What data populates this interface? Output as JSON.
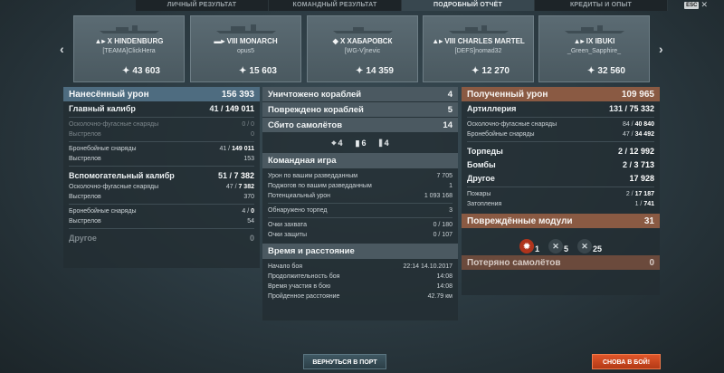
{
  "tabs": [
    "ЛИЧНЫЙ РЕЗУЛЬТАТ",
    "КОМАНДНЫЙ РЕЗУЛЬТАТ",
    "ПОДРОБНЫЙ ОТЧЁТ",
    "КРЕДИТЫ И ОПЫТ"
  ],
  "active_tab": 2,
  "esc_label": "ESC",
  "ships": [
    {
      "tier": "X",
      "name": "HINDENBURG",
      "player": "[TEAMA]ClickHera",
      "damage": "43 603",
      "class_icon": "cruiser-icon"
    },
    {
      "tier": "VIII",
      "name": "MONARCH",
      "player": "opus5",
      "damage": "15 603",
      "class_icon": "battleship-icon"
    },
    {
      "tier": "X",
      "name": "ХАБАРОВСК",
      "player": "[WG-V]nevic",
      "damage": "14 359",
      "class_icon": "destroyer-icon"
    },
    {
      "tier": "VIII",
      "name": "CHARLES MARTEL",
      "player": "[DEFS]nomad32",
      "damage": "12 270",
      "class_icon": "cruiser-icon"
    },
    {
      "tier": "IX",
      "name": "IBUKI",
      "player": "_Green_Sapphire_",
      "damage": "32 560",
      "class_icon": "cruiser-icon"
    }
  ],
  "left": {
    "dealt_label": "Нанесённый урон",
    "dealt_value": "156 393",
    "main_label": "Главный калибр",
    "main_a": "41 / ",
    "main_b": "149 011",
    "main_he_label": "Осколочно-фугасные снаряды",
    "main_he_value": "0 / 0",
    "main_he_shots_label": "Выстрелов",
    "main_he_shots": "0",
    "main_ap_label": "Бронебойные снаряды",
    "main_ap_a": "41 / ",
    "main_ap_b": "149 011",
    "main_ap_shots_label": "Выстрелов",
    "main_ap_shots": "153",
    "sec_label": "Вспомогательный калибр",
    "sec_a": "51 / ",
    "sec_b": "7 382",
    "sec_he_label": "Осколочно-фугасные снаряды",
    "sec_he_a": "47 / ",
    "sec_he_b": "7 382",
    "sec_he_shots_label": "Выстрелов",
    "sec_he_shots": "370",
    "sec_ap_label": "Бронебойные снаряды",
    "sec_ap_a": "4 / ",
    "sec_ap_b": "0",
    "sec_ap_shots_label": "Выстрелов",
    "sec_ap_shots": "54",
    "other_label": "Другое",
    "other_value": "0"
  },
  "mid": {
    "destroyed_label": "Уничтожено кораблей",
    "destroyed_value": "4",
    "damaged_label": "Повреждено кораблей",
    "damaged_value": "5",
    "planes_label": "Сбито самолётов",
    "planes_value": "14",
    "icon_counts": {
      "ribbon1": "4",
      "ribbon2": "6",
      "ribbon3": "4"
    },
    "team_label": "Командная игра",
    "team_rows": [
      {
        "label": "Урон по вашим разведданным",
        "value": "7 705"
      },
      {
        "label": "Поджогов по вашим разведданным",
        "value": "1"
      },
      {
        "label": "Потенциальный урон",
        "value": "1 093 168"
      },
      {
        "label": "Обнаружено торпед",
        "value": "3"
      },
      {
        "label": "Очки захвата",
        "value": "0 / 180"
      },
      {
        "label": "Очки защиты",
        "value": "0 / 107"
      }
    ],
    "time_label": "Время и расстояние",
    "time_rows": [
      {
        "label": "Начало боя",
        "value": "22:14  14.10.2017"
      },
      {
        "label": "Продолжительность боя",
        "value": "14:08"
      },
      {
        "label": "Время участия в бою",
        "value": "14:08"
      },
      {
        "label": "Пройденное расстояние",
        "value": "42.79 км"
      }
    ]
  },
  "right": {
    "received_label": "Полученный урон",
    "received_value": "109 965",
    "artillery_label": "Артиллерия",
    "artillery_a": "131 / ",
    "artillery_b": "75 332",
    "he_label": "Осколочно-фугасные снаряды",
    "he_a": "84 / ",
    "he_b": "40 840",
    "ap_label": "Бронебойные снаряды",
    "ap_a": "47 / ",
    "ap_b": "34 492",
    "torp_label": "Торпеды",
    "torp_a": "2 / ",
    "torp_b": "12 992",
    "bombs_label": "Бомбы",
    "bombs_a": "2 / ",
    "bombs_b": "3 713",
    "other_label": "Другое",
    "other_value": "17 928",
    "fires_label": "Пожары",
    "fires_a": "2 / ",
    "fires_b": "17 187",
    "floods_label": "Затопления",
    "floods_a": "1 / ",
    "floods_b": "741",
    "modules_label": "Повреждённые модули",
    "modules_value": "31",
    "module_counts": {
      "fire": "1",
      "rudder": "5",
      "turret": "25"
    },
    "planes_lost_label": "Потеряно самолётов",
    "planes_lost_value": "0"
  },
  "buttons": {
    "port": "ВЕРНУТЬСЯ В ПОРТ",
    "battle": "СНОВА В БОЙ!"
  },
  "colors": {
    "header_blue": "#4e6c80",
    "header_orange": "#8a5a43",
    "battle_button": "#d44a1f"
  }
}
